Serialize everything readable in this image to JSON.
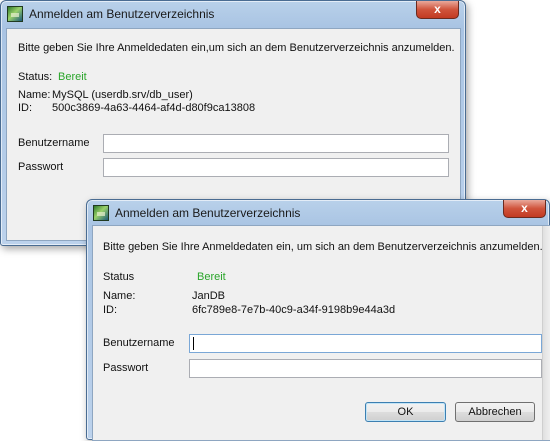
{
  "dialog_back": {
    "title": "Anmelden am Benutzerverzeichnis",
    "close_glyph": "x",
    "intro": "Bitte geben Sie Ihre Anmeldedaten ein,um sich an dem Benutzerverzeichnis anzumelden.",
    "status_label": "Status:",
    "status_value": "Bereit",
    "name_label": "Name:",
    "name_value": "MySQL (userdb.srv/db_user)",
    "id_label": "ID:",
    "id_value": "500c3869-4a63-4464-af4d-d80f9ca13808",
    "username_label": "Benutzername",
    "username_value": "",
    "password_label": "Passwort",
    "password_value": ""
  },
  "dialog_front": {
    "title": "Anmelden am Benutzerverzeichnis",
    "close_glyph": "x",
    "intro": "Bitte geben Sie Ihre Anmeldedaten ein, um sich an dem Benutzerverzeichnis anzumelden.",
    "status_label": "Status",
    "status_value": "Bereit",
    "name_label": "Name:",
    "name_value": "JanDB",
    "id_label": "ID:",
    "id_value": "6fc789e8-7e7b-40c9-a34f-9198b9e44a3d",
    "username_label": "Benutzername",
    "username_value": "",
    "password_label": "Passwort",
    "password_value": "",
    "ok_label": "OK",
    "cancel_label": "Abbrechen"
  },
  "colors": {
    "status_ready": "#2aa52a",
    "titlebar": "#b9d1ea",
    "close_button": "#c84a32"
  }
}
